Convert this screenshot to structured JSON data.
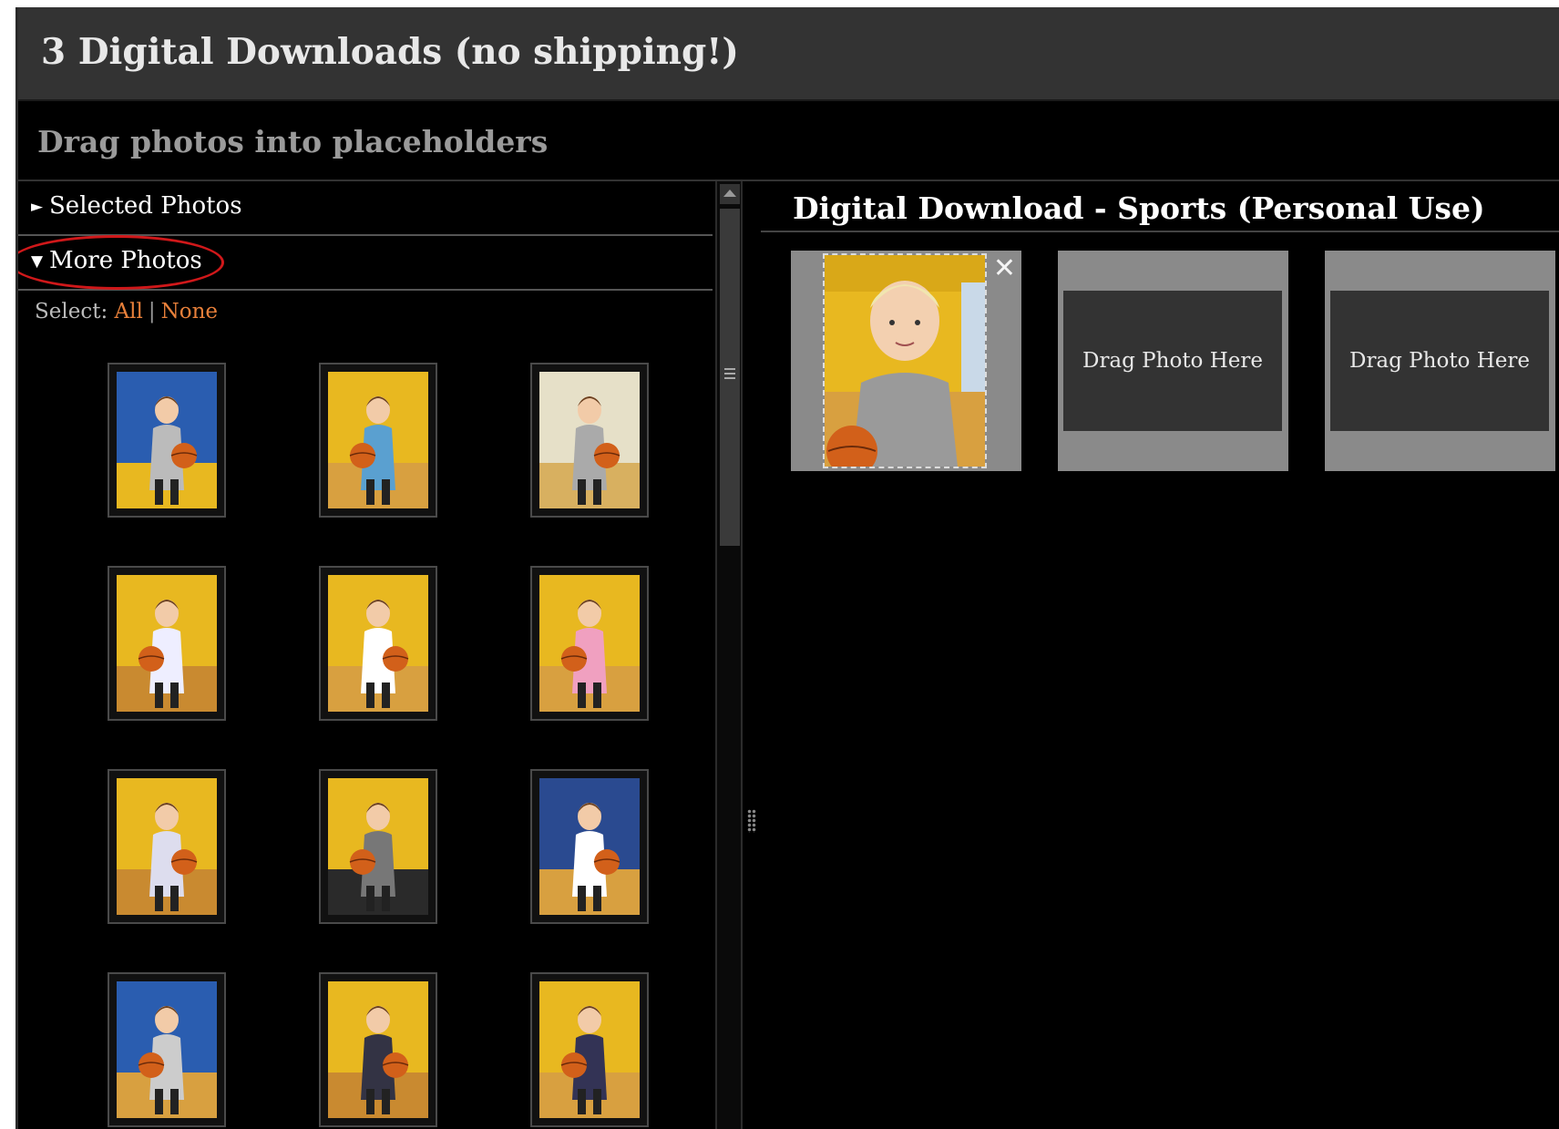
{
  "header": {
    "title": "3 Digital Downloads (no shipping!)",
    "subtitle": "Drag photos into placeholders"
  },
  "left_panel": {
    "sections": [
      {
        "label": "Selected Photos",
        "expanded": false,
        "arrow": "►"
      },
      {
        "label": "More Photos",
        "expanded": true,
        "arrow": "▼"
      }
    ],
    "select": {
      "label": "Select: ",
      "all": "All",
      "separator": "|",
      "none": "None"
    },
    "photos": [
      {
        "name": "girl-blue-wall-basketball"
      },
      {
        "name": "two-kids-basketball"
      },
      {
        "name": "boy-court-wide"
      },
      {
        "name": "boy-shooting-basketball"
      },
      {
        "name": "girl-holding-basketball"
      },
      {
        "name": "girl-pink-pants-basketball"
      },
      {
        "name": "boy-striped-jersey"
      },
      {
        "name": "boy-gray-shirt-basketball"
      },
      {
        "name": "girl-blue-wall-pink-shorts"
      },
      {
        "name": "blond-boy-basketball"
      },
      {
        "name": "girl-love-shirt-dribbling"
      },
      {
        "name": "girls-multiple-basketballs"
      }
    ]
  },
  "right_panel": {
    "product_title": "Digital Download - Sports (Personal Use)",
    "slots": [
      {
        "filled": true,
        "photo": "blond-boy-portrait",
        "close_icon": "close-icon"
      },
      {
        "filled": false,
        "label": "Drag Photo Here"
      },
      {
        "filled": false,
        "label": "Drag Photo Here"
      }
    ]
  },
  "colors": {
    "title_bar": "#333333",
    "background": "#000000",
    "link_orange": "#e8803a",
    "annotation_red": "#d0181a",
    "slot_gray": "#8a8a8a",
    "court_yellow": "#f0c020"
  }
}
